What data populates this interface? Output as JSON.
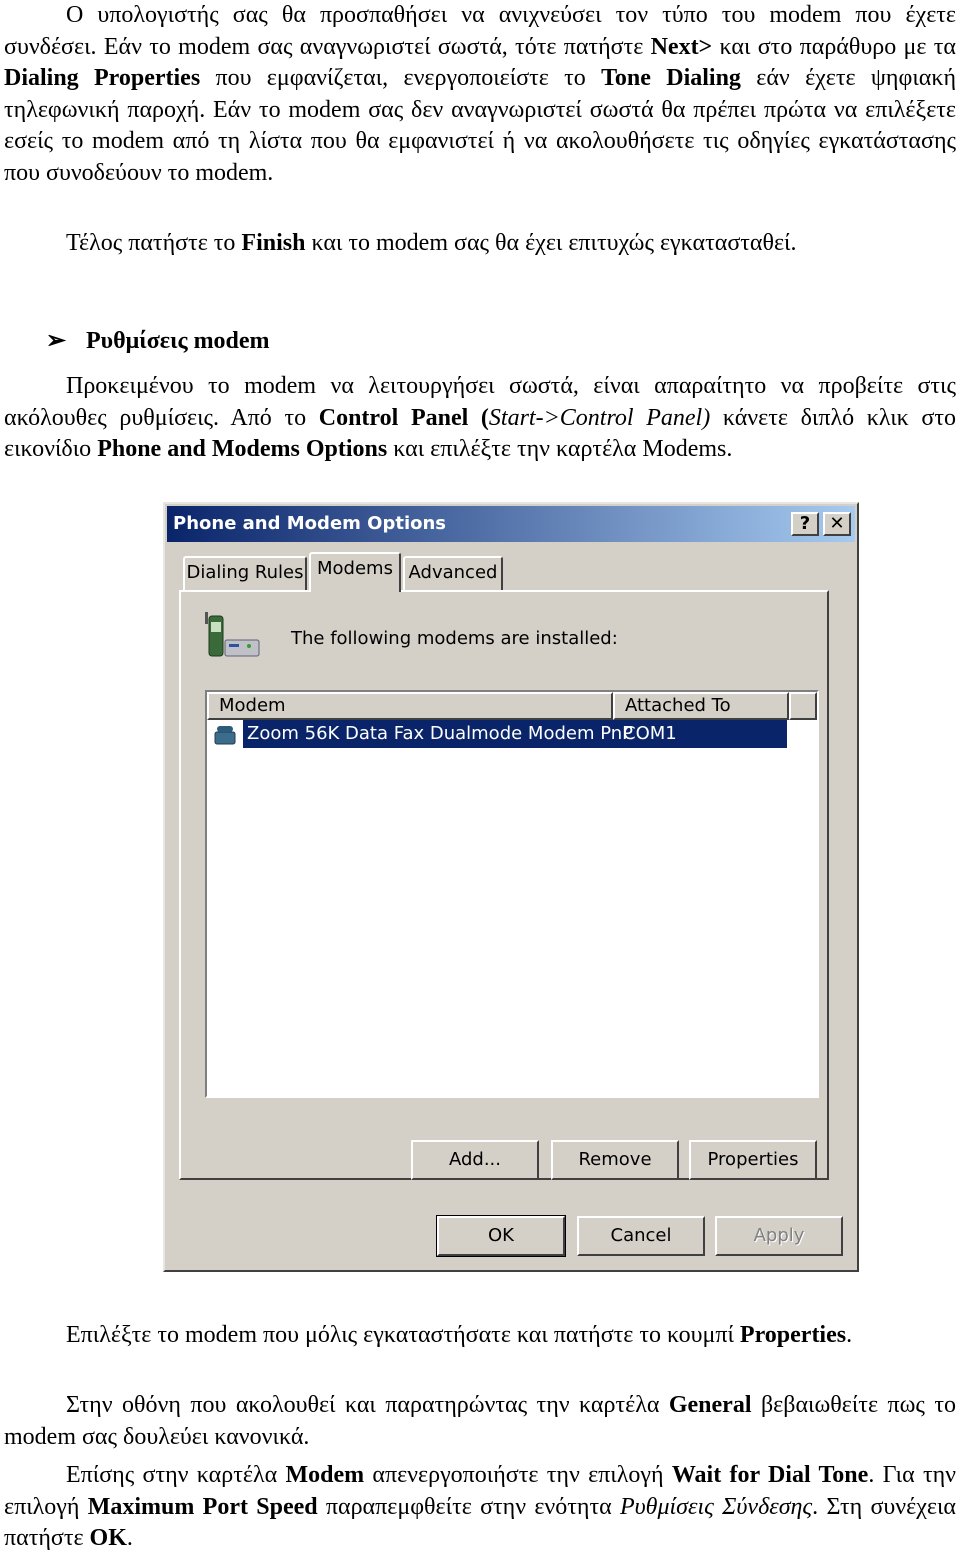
{
  "paragraphs": {
    "p1": {
      "s1": "Ο υπολογιστής σας θα προσπαθήσει να ανιχνεύσει τον τύπο του modem που έχετε συνδέσει. Εάν το modem σας αναγνωριστεί σωστά, τότε πατήστε ",
      "b1": "Next>",
      "s2": " και στο παράθυρο με τα ",
      "b2": "Dialing Properties",
      "s3": " που εμφανίζεται, ενεργοποιείστε το ",
      "b3": "Tone Dialing",
      "s4": " εάν έχετε ψηφιακή τηλεφωνική παροχή. Εάν το modem σας δεν αναγνωριστεί σωστά θα πρέπει πρώτα να επιλέξετε εσείς το modem από τη λίστα που θα εμφανιστεί ή να ακολουθήσετε τις οδηγίες εγκατάστασης που συνοδεύουν το modem."
    },
    "p2": {
      "s1": "Τέλος πατήστε το ",
      "b1": "Finish",
      "s2": " και το modem σας θα έχει επιτυχώς εγκατασταθεί."
    },
    "heading": "Ρυθμίσεις modem",
    "p3": {
      "s1": "Προκειμένου το modem να λειτουργήσει σωστά, είναι απαραίτητο να προβείτε στις ακόλουθες ρυθμίσεις. Από το ",
      "b1": "Control Panel (",
      "i1": "Start->Control Panel)",
      "s2": " κάνετε διπλό κλικ στο εικονίδιο ",
      "b2": "Phone and Modems Options",
      "s3": " και επιλέξτε την καρτέλα Modems."
    },
    "p4": {
      "s1": "Επιλέξτε το modem που μόλις εγκαταστήσατε και πατήστε το κουμπί ",
      "b1": "Properties",
      "s2": "."
    },
    "p5": {
      "s1": "Στην οθόνη που ακολουθεί και παρατηρώντας την καρτέλα ",
      "b1": "General",
      "s2": " βεβαιωθείτε πως το modem σας δουλεύει κανονικά."
    },
    "p6": {
      "s1": "Επίσης στην καρτέλα ",
      "b1": "Modem",
      "s2": " απενεργοποιήστε την επιλογή ",
      "b2": "Wait for Dial Tone",
      "s3": ". Για την επιλογή ",
      "b3": "Maximum Port Speed",
      "s4": " παραπεμφθείτε στην ενότητα ",
      "i1": "Ρυθμίσεις Σύνδεσης",
      "s5": ". Στη συνέχεια πατήστε ",
      "b4": "OK",
      "s6": "."
    }
  },
  "dialog": {
    "title": "Phone and Modem Options",
    "help_btn": "?",
    "close_btn": "✕",
    "tabs": [
      "Dialing Rules",
      "Modems",
      "Advanced"
    ],
    "installed_text": "The following modems are  installed:",
    "columns": [
      "Modem",
      "Attached To"
    ],
    "row": {
      "modem": "Zoom 56K Data Fax Dualmode Modem PnP",
      "port": "COM1"
    },
    "buttons": {
      "add": "Add...",
      "remove": "Remove",
      "properties": "Properties",
      "ok": "OK",
      "cancel": "Cancel",
      "apply": "Apply"
    },
    "colors": {
      "title_start": "#0a246a",
      "title_end": "#a6caf0",
      "face": "#d4d0c8"
    }
  }
}
